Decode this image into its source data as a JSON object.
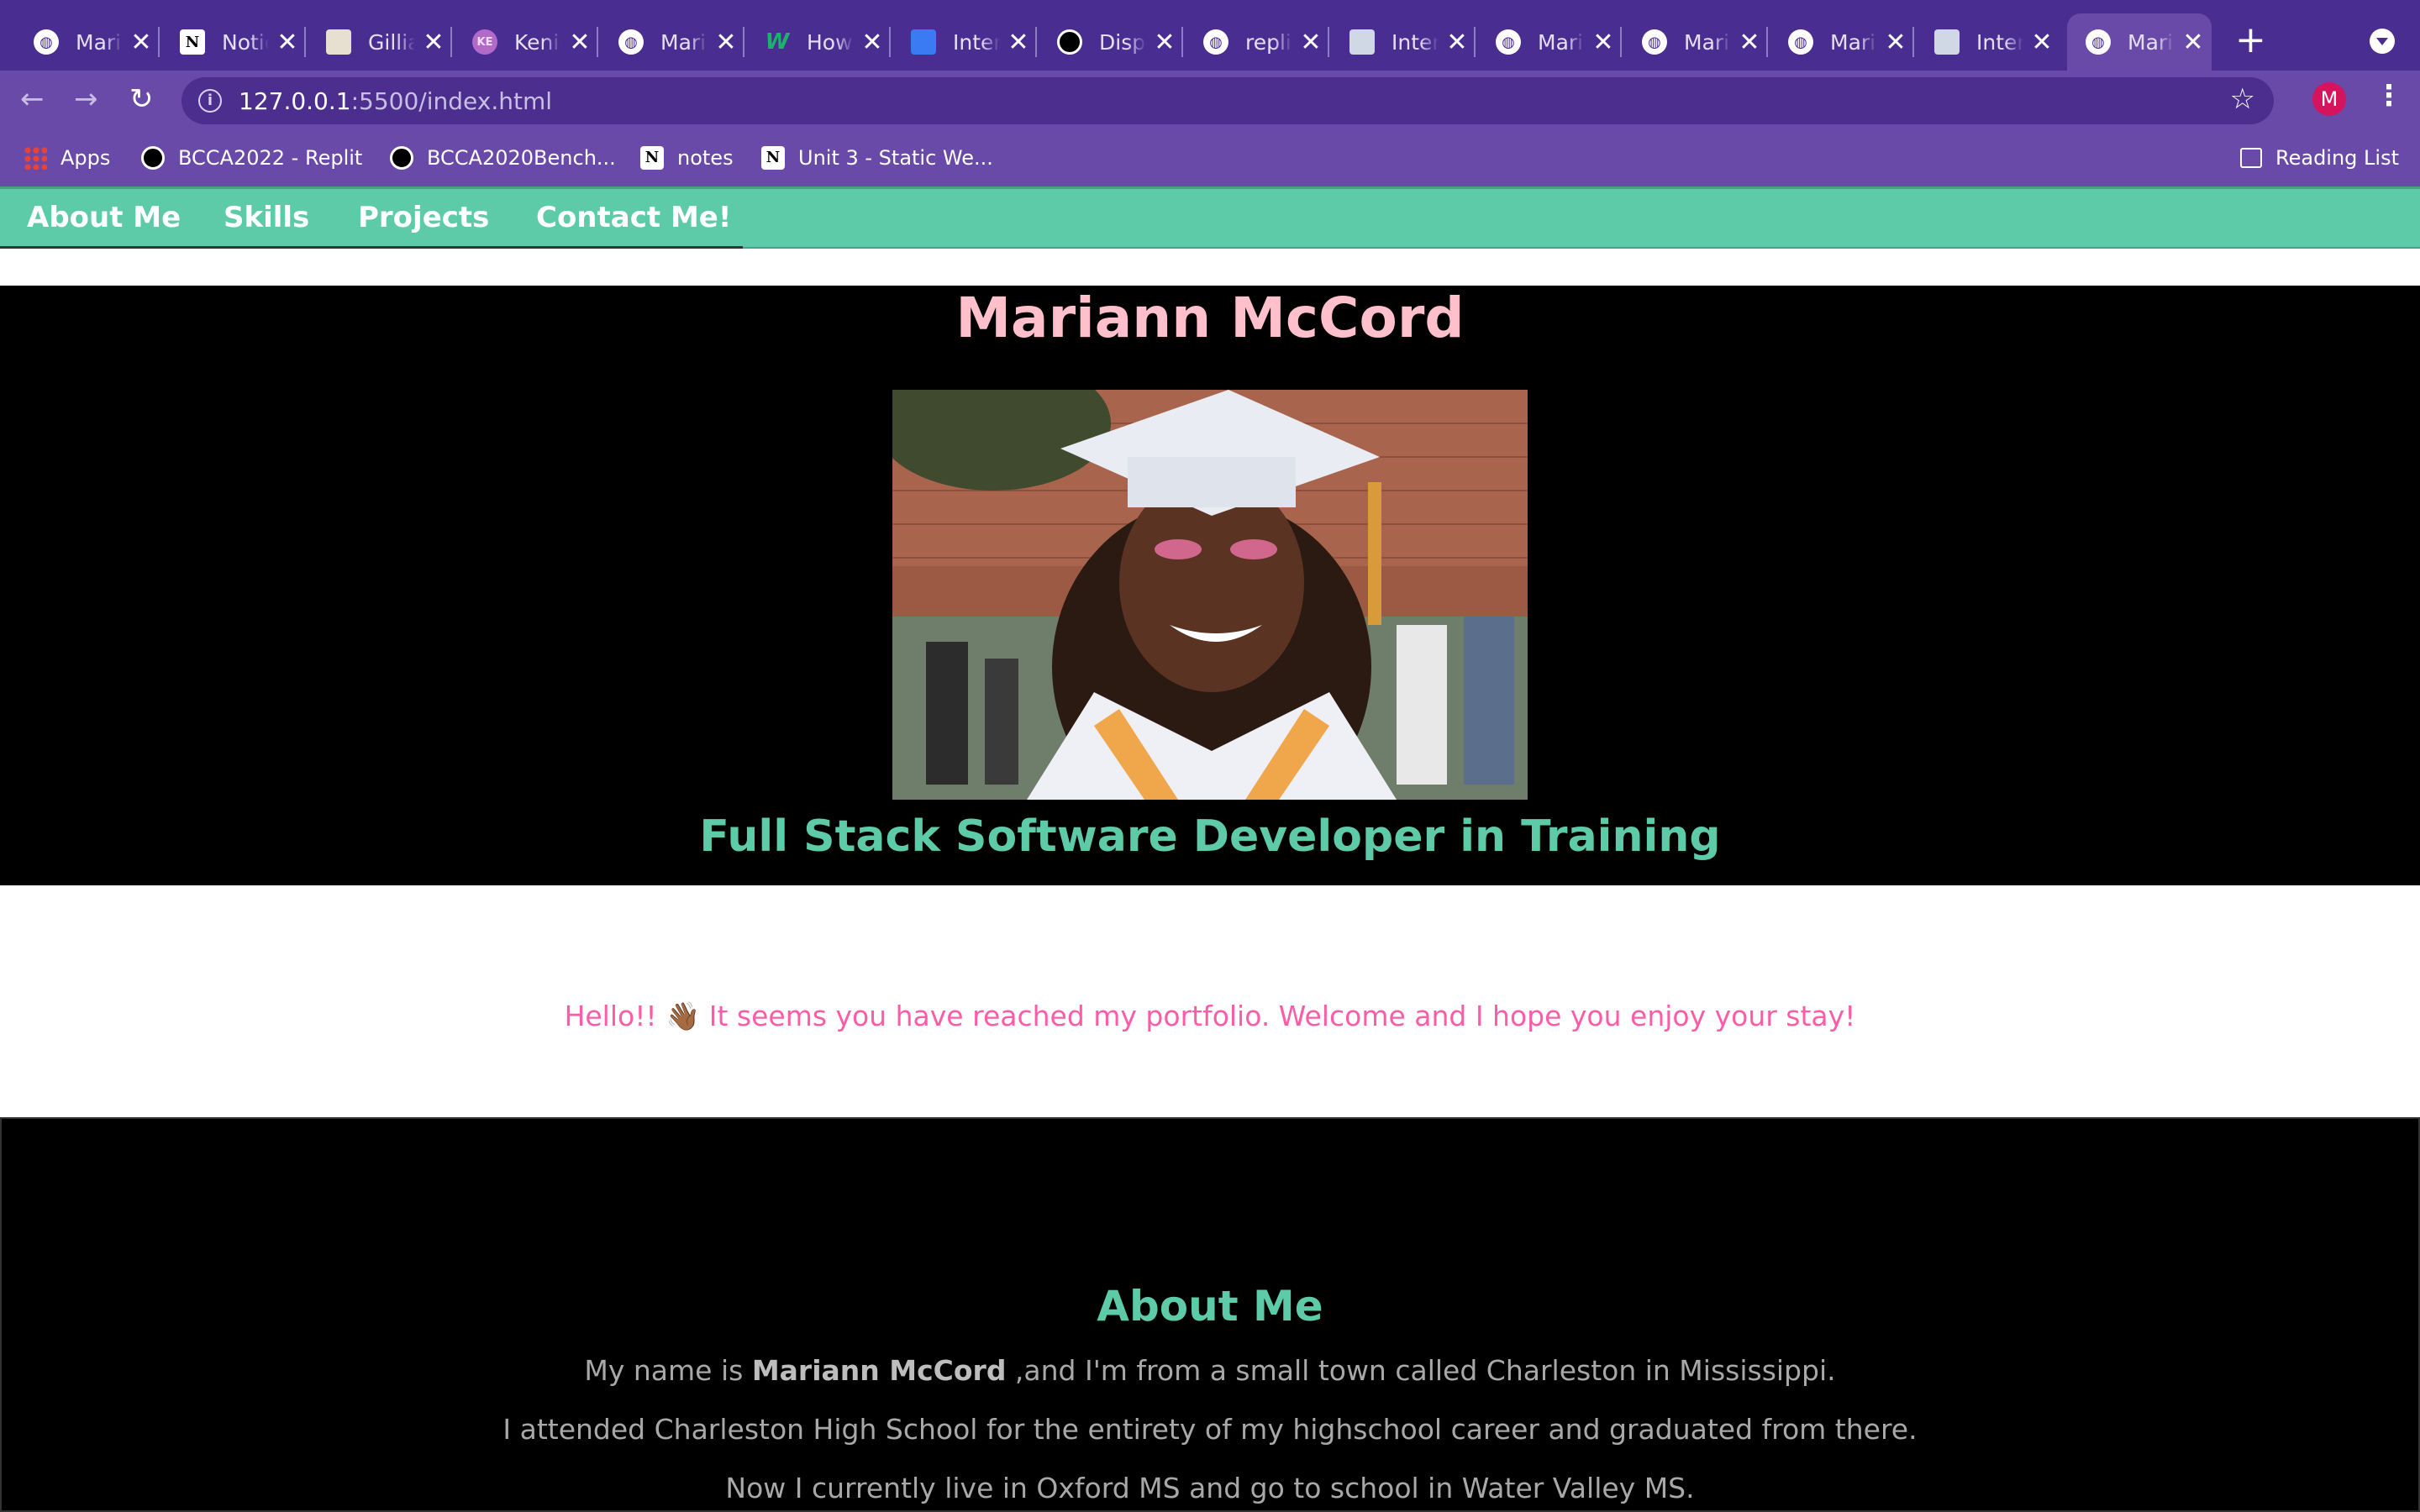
{
  "browser": {
    "tabs": [
      {
        "title": "Mariann",
        "icon": "globe-icon"
      },
      {
        "title": "Notion",
        "icon": "notion-icon"
      },
      {
        "title": "Gillian",
        "icon": "school-icon"
      },
      {
        "title": "Kenia",
        "icon": "ke-avatar-icon"
      },
      {
        "title": "Mariann",
        "icon": "globe-icon"
      },
      {
        "title": "How",
        "icon": "w-icon"
      },
      {
        "title": "Internet",
        "icon": "docs-icon"
      },
      {
        "title": "Display",
        "icon": "replit-icon"
      },
      {
        "title": "replit",
        "icon": "globe-icon"
      },
      {
        "title": "Interactive",
        "icon": "cube-icon"
      },
      {
        "title": "Mariann",
        "icon": "globe-icon"
      },
      {
        "title": "Mariann",
        "icon": "globe-icon"
      },
      {
        "title": "Mariann",
        "icon": "globe-icon"
      },
      {
        "title": "Interactive",
        "icon": "cube-icon"
      },
      {
        "title": "Mariann",
        "icon": "globe-icon"
      }
    ],
    "url_host": "127.0.0.1",
    "url_rest": ":5500/index.html",
    "profile_initial": "M",
    "bookmarks": [
      "Apps",
      "BCCA2022 - Replit",
      "BCCA2020Bench...",
      "notes",
      "Unit 3 - Static We..."
    ],
    "reading_list": "Reading List"
  },
  "nav": {
    "links": [
      "About Me",
      "Skills",
      "Projects",
      "Contact Me!"
    ]
  },
  "hero": {
    "name": "Mariann McCord",
    "subtitle": "Full Stack Software Developer in Training"
  },
  "welcome": "Hello!! 👋🏾 It seems you have reached my portfolio. Welcome and I hope you enjoy your stay!",
  "about": {
    "heading": "About Me",
    "line1_pre": "My name is ",
    "line1_bold": "Mariann McCord",
    "line1_post": " ,and I'm from a small town called Charleston in Mississippi.",
    "line2": "I attended Charleston High School for the entirety of my highschool career and graduated from there.",
    "line3": "Now I currently live in Oxford MS and go to school in Water Valley MS."
  },
  "colors": {
    "tab_bar": "#4a2d91",
    "toolbar": "#6a4aa8",
    "nav_bg": "#5ecba8",
    "name_pink": "#ffc0cb",
    "welcome_pink": "#ff5ca8"
  }
}
